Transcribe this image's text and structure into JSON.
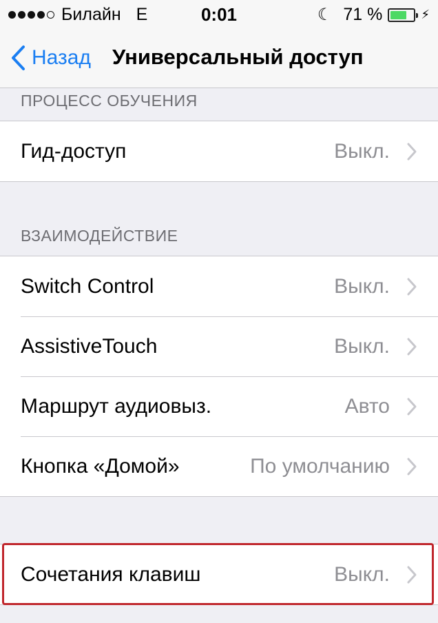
{
  "status_bar": {
    "carrier": "Билайн",
    "network": "E",
    "time": "0:01",
    "battery_text": "71 %",
    "battery_level": 0.71,
    "signal_bars": 4,
    "icons": [
      "signal-dots-icon",
      "moon-icon",
      "battery-icon",
      "charging-bolt-icon"
    ]
  },
  "nav": {
    "back_label": "Назад",
    "title": "Универсальный доступ"
  },
  "sections": {
    "learning": {
      "header": "ПРОЦЕСС ОБУЧЕНИЯ",
      "items": [
        {
          "label": "Гид-доступ",
          "value": "Выкл."
        }
      ]
    },
    "interaction": {
      "header": "ВЗАИМОДЕЙСТВИЕ",
      "items": [
        {
          "label": "Switch Control",
          "value": "Выкл."
        },
        {
          "label": "AssistiveTouch",
          "value": "Выкл."
        },
        {
          "label": "Маршрут аудиовыз.",
          "value": "Авто"
        },
        {
          "label": "Кнопка «Домой»",
          "value": "По умолчанию"
        }
      ]
    },
    "shortcuts": {
      "items": [
        {
          "label": "Сочетания клавиш",
          "value": "Выкл."
        }
      ]
    }
  },
  "colors": {
    "accent": "#1a7ef2",
    "background": "#efeff4",
    "value_text": "#8e8e93",
    "highlight": "#c0262c",
    "battery": "#4cd964"
  }
}
